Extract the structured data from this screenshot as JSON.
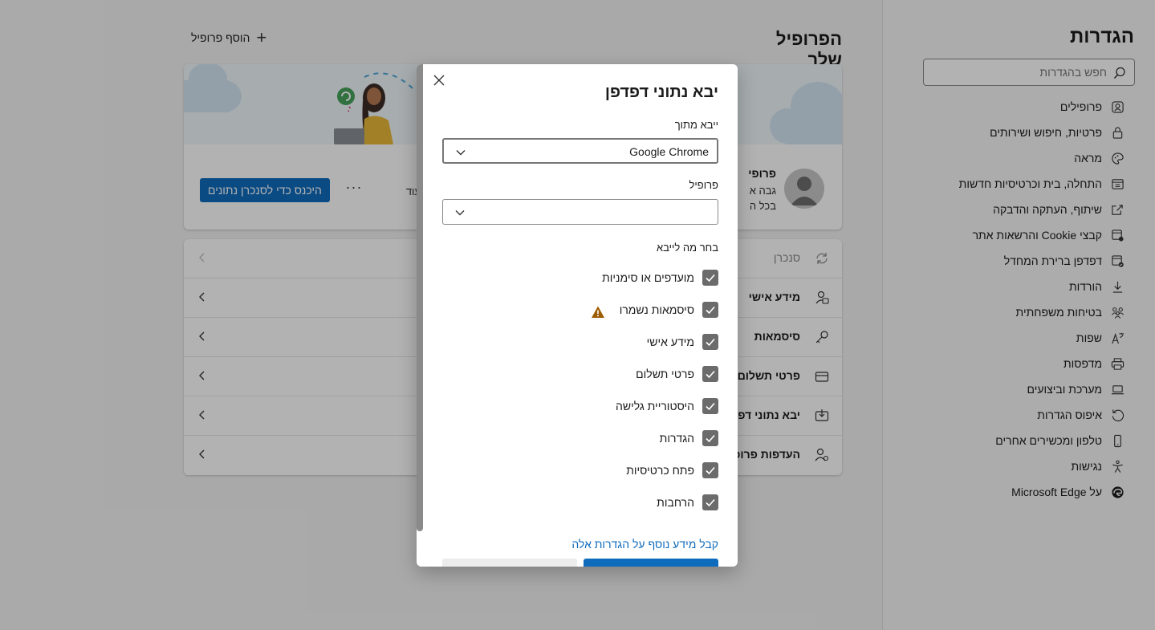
{
  "sidebar": {
    "title": "הגדרות",
    "search_placeholder": "חפש בהגדרות",
    "items": [
      {
        "label": "פרופילים",
        "icon": "profile-icon"
      },
      {
        "label": "פרטיות, חיפוש ושירותים",
        "icon": "lock-icon"
      },
      {
        "label": "מראה",
        "icon": "palette-icon"
      },
      {
        "label": "התחלה, בית וכרטיסיות חדשות",
        "icon": "home-tabs-icon"
      },
      {
        "label": "שיתוף, העתקה והדבקה",
        "icon": "share-icon"
      },
      {
        "label": "קבצי Cookie והרשאות אתר",
        "icon": "cookie-permissions-icon"
      },
      {
        "label": "דפדפן ברירת המחדל",
        "icon": "default-browser-icon"
      },
      {
        "label": "הורדות",
        "icon": "download-icon"
      },
      {
        "label": "בטיחות משפחתית",
        "icon": "family-icon"
      },
      {
        "label": "שפות",
        "icon": "languages-icon"
      },
      {
        "label": "מדפסות",
        "icon": "printer-icon"
      },
      {
        "label": "מערכת וביצועים",
        "icon": "laptop-icon"
      },
      {
        "label": "איפוס הגדרות",
        "icon": "reset-icon"
      },
      {
        "label": "טלפון ומכשירים אחרים",
        "icon": "phone-icon"
      },
      {
        "label": "נגישות",
        "icon": "accessibility-icon"
      },
      {
        "label": "על Microsoft Edge",
        "icon": "edge-logo-icon"
      }
    ]
  },
  "main": {
    "page_title": "הפרופיל שלך",
    "add_profile_label": "הוסף פרופיל",
    "profile": {
      "name": "פרופי",
      "sub1": "גבה א",
      "sub2": "בכל ה",
      "manage_partial": "עוד",
      "sync_button": "היכנס כדי לסנכרן נתונים",
      "more_label": "···"
    },
    "rows": [
      {
        "label": "סנכרן",
        "icon": "sync-icon",
        "disabled": true
      },
      {
        "label": "מידע אישי",
        "icon": "person-info-icon"
      },
      {
        "label": "סיסמאות",
        "icon": "key-icon"
      },
      {
        "label": "פרטי תשלום",
        "icon": "credit-card-icon"
      },
      {
        "label": "יבא נתוני דפדפן",
        "icon": "import-icon"
      },
      {
        "label": "העדפות פרופיל",
        "icon": "profile-settings-icon"
      }
    ]
  },
  "dialog": {
    "title": "יבא נתוני דפדפן",
    "import_from_label": "ייבא מתוך",
    "import_from_value": "Google Chrome",
    "profile_label": "פרופיל",
    "profile_value": "",
    "choose_label": "בחר מה לייבא",
    "options": [
      {
        "label": "מועדפים או סימניות",
        "checked": true
      },
      {
        "label": "סיסמאות נשמרו",
        "checked": true,
        "warning": true
      },
      {
        "label": "מידע אישי",
        "checked": true
      },
      {
        "label": "פרטי תשלום",
        "checked": true
      },
      {
        "label": "היסטוריית גלישה",
        "checked": true
      },
      {
        "label": "הגדרות",
        "checked": true
      },
      {
        "label": "פתח כרטיסיות",
        "checked": true
      },
      {
        "label": "הרחבות",
        "checked": true
      }
    ],
    "learn_more": "קבל מידע נוסף על הגדרות אלה"
  },
  "colors": {
    "accent": "#0f6cbd",
    "checkbox": "#6b6b6b",
    "warning": "#9d5d00",
    "overlay": "rgba(0,0,0,0.30)"
  }
}
